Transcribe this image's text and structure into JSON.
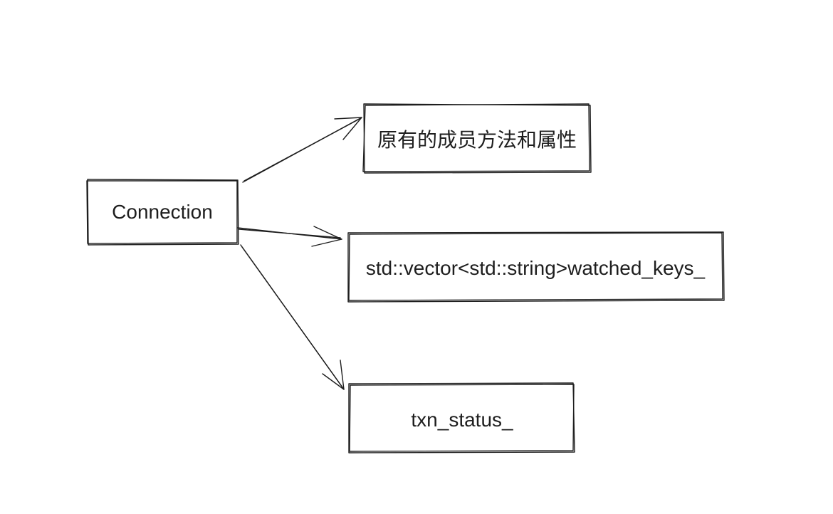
{
  "diagram": {
    "nodes": [
      {
        "id": "connection",
        "label": "Connection"
      },
      {
        "id": "methods",
        "label": "原有的成员方法和属性"
      },
      {
        "id": "watched-keys",
        "label": "std::vector<std::string>watched_keys_"
      },
      {
        "id": "txn-status",
        "label": "txn_status_"
      }
    ],
    "edges": [
      {
        "from": "connection",
        "to": "methods"
      },
      {
        "from": "connection",
        "to": "watched-keys"
      },
      {
        "from": "connection",
        "to": "txn-status"
      }
    ],
    "colors": {
      "stroke": "#1e1e1e",
      "background": "#ffffff",
      "text": "#1e1e1e"
    }
  }
}
